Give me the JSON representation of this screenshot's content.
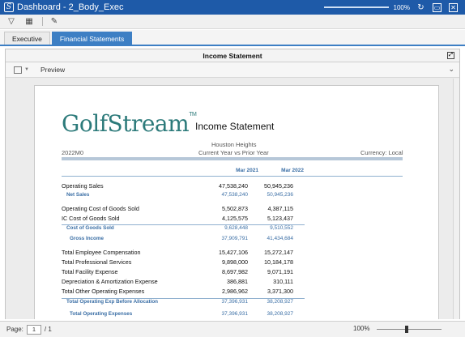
{
  "window": {
    "title": "Dashboard - 2_Body_Exec",
    "app_icon": "S",
    "zoom_label": "100%",
    "zoom_level": 1.0
  },
  "toolbar": {
    "icons": [
      "filter-icon",
      "grid-icon",
      "pencil-icon"
    ]
  },
  "tabs": [
    {
      "label": "Executive",
      "active": false
    },
    {
      "label": "Financial Statements",
      "active": true
    }
  ],
  "panel": {
    "title": "Income Statement",
    "preview_label": "Preview"
  },
  "report": {
    "logo_text": "GolfStream",
    "logo_tm": "TM",
    "title": "Income Statement",
    "entity": "Houston Heights",
    "comparison": "Current Year vs Prior Year",
    "scenario": "2022M0",
    "currency": "Currency: Local",
    "columns": [
      "Mar 2021",
      "Mar 2022"
    ],
    "rows": [
      {
        "label": "Operating Sales",
        "v1": "47,538,240",
        "v2": "50,945,236",
        "style": "normal"
      },
      {
        "label": "Net Sales",
        "v1": "47,538,240",
        "v2": "50,945,236",
        "style": "sub"
      },
      {
        "label": "Operating Cost of Goods Sold",
        "v1": "5,502,873",
        "v2": "4,387,115",
        "style": "normal"
      },
      {
        "label": "IC Cost of Goods Sold",
        "v1": "4,125,575",
        "v2": "5,123,437",
        "style": "normal"
      },
      {
        "label": "Cost of Goods Sold",
        "v1": "9,628,448",
        "v2": "9,510,552",
        "style": "sub"
      },
      {
        "label": "Gross Income",
        "v1": "37,909,791",
        "v2": "41,434,684",
        "style": "sub2"
      },
      {
        "label": "Total Employee Compensation",
        "v1": "15,427,106",
        "v2": "15,272,147",
        "style": "normal"
      },
      {
        "label": "Total Professional Services",
        "v1": "9,898,000",
        "v2": "10,184,178",
        "style": "normal"
      },
      {
        "label": "Total Facility Expense",
        "v1": "8,697,982",
        "v2": "9,071,191",
        "style": "normal"
      },
      {
        "label": "Depreciation & Amortization Expense",
        "v1": "386,881",
        "v2": "310,111",
        "style": "normal"
      },
      {
        "label": "Total Other Operating Expenses",
        "v1": "2,986,962",
        "v2": "3,371,300",
        "style": "normal"
      },
      {
        "label": "Total Operating Exp Before Allocation",
        "v1": "37,396,931",
        "v2": "38,208,927",
        "style": "sub"
      },
      {
        "label": "Total Operating Expenses",
        "v1": "37,396,931",
        "v2": "38,208,927",
        "style": "sub2"
      }
    ]
  },
  "statusbar": {
    "page_label": "Page:",
    "page_value": "1",
    "page_total": "/ 1",
    "zoom_label": "100%"
  }
}
